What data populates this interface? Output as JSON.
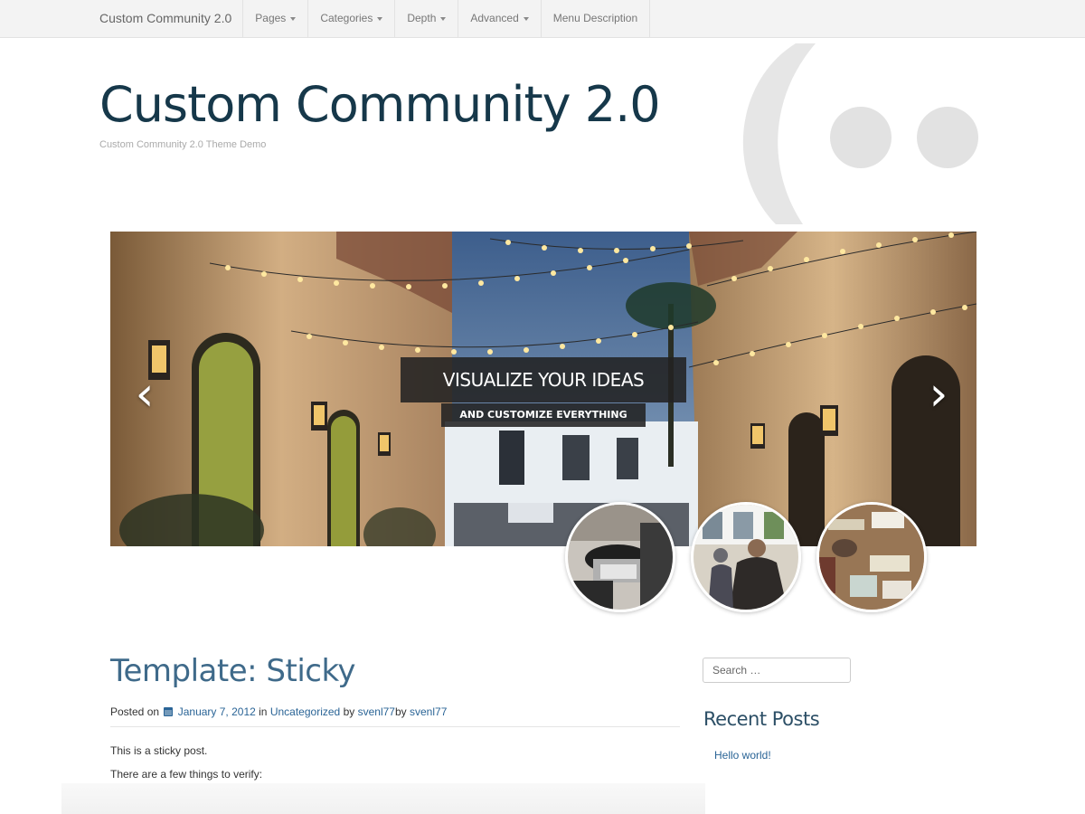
{
  "nav": {
    "brand": "Custom Community 2.0",
    "items": [
      {
        "label": "Pages",
        "dropdown": true
      },
      {
        "label": "Categories",
        "dropdown": true
      },
      {
        "label": "Depth",
        "dropdown": true
      },
      {
        "label": "Advanced",
        "dropdown": true
      },
      {
        "label": "Menu Description",
        "dropdown": false
      }
    ]
  },
  "header": {
    "title": "Custom Community 2.0",
    "description": "Custom Community 2.0 Theme Demo"
  },
  "slider": {
    "caption_title": "VISUALIZE YOUR IDEAS",
    "caption_subtitle": "AND CUSTOMIZE EVERYTHING",
    "prev_icon": "chevron-left-icon",
    "next_icon": "chevron-right-icon",
    "thumbnails": [
      {
        "subject": "espresso portafilter"
      },
      {
        "subject": "cafe patrons"
      },
      {
        "subject": "wall signs"
      }
    ]
  },
  "post": {
    "title": "Template: Sticky",
    "meta": {
      "posted_on": "Posted on",
      "date": "January 7, 2012",
      "in": "in",
      "category": "Uncategorized",
      "by": "by",
      "author": "svenl77",
      "by2": "by",
      "author2": "svenl77"
    },
    "paragraphs": [
      "This is a sticky post.",
      "There are a few things to verify:"
    ]
  },
  "sidebar": {
    "search_placeholder": "Search …",
    "recent_posts_title": "Recent Posts",
    "recent_posts": [
      "Hello world!"
    ]
  },
  "colors": {
    "title": "#16384a",
    "post_title": "#3f6a8a",
    "link": "#2a6496",
    "nav_bg": "#f3f3f3"
  }
}
